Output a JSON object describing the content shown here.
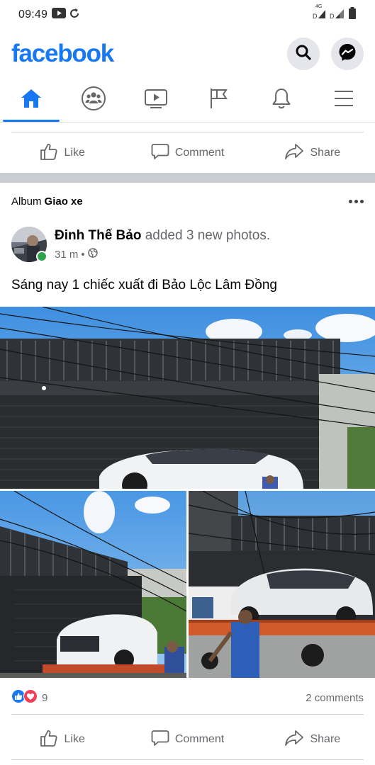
{
  "status_bar": {
    "time": "09:49",
    "network_label": "4G",
    "icons": [
      "youtube-icon",
      "sync-icon",
      "signal-icon",
      "signal-icon",
      "battery-icon"
    ]
  },
  "header": {
    "logo": "facebook",
    "search_icon": "search-icon",
    "messenger_icon": "messenger-icon"
  },
  "nav": {
    "tabs": [
      {
        "name": "home",
        "icon": "home-icon",
        "active": true
      },
      {
        "name": "groups",
        "icon": "groups-icon",
        "active": false
      },
      {
        "name": "watch",
        "icon": "video-icon",
        "active": false
      },
      {
        "name": "pages",
        "icon": "flag-icon",
        "active": false
      },
      {
        "name": "notifications",
        "icon": "bell-icon",
        "active": false
      },
      {
        "name": "menu",
        "icon": "hamburger-icon",
        "active": false
      }
    ]
  },
  "prev_post_actions": {
    "like": "Like",
    "comment": "Comment",
    "share": "Share"
  },
  "post": {
    "album_prefix": "Album",
    "album_name": "Giao xe",
    "author": "Đinh Thế Bảo",
    "action": "added 3 new photos.",
    "time": "31 m",
    "separator": "•",
    "privacy_icon": "globe-icon",
    "text": "Sáng nay 1 chiếc xuất đi Bảo Lộc Lâm Đồng",
    "reaction_count": "9",
    "reaction_icons": [
      "like-reaction-icon",
      "love-reaction-icon"
    ],
    "comments": "2 comments",
    "actions": {
      "like": "Like",
      "comment": "Comment",
      "share": "Share"
    }
  },
  "colors": {
    "brand": "#1877f2",
    "secondary_text": "#65676b",
    "online": "#31a24c",
    "love": "#f33e58"
  }
}
